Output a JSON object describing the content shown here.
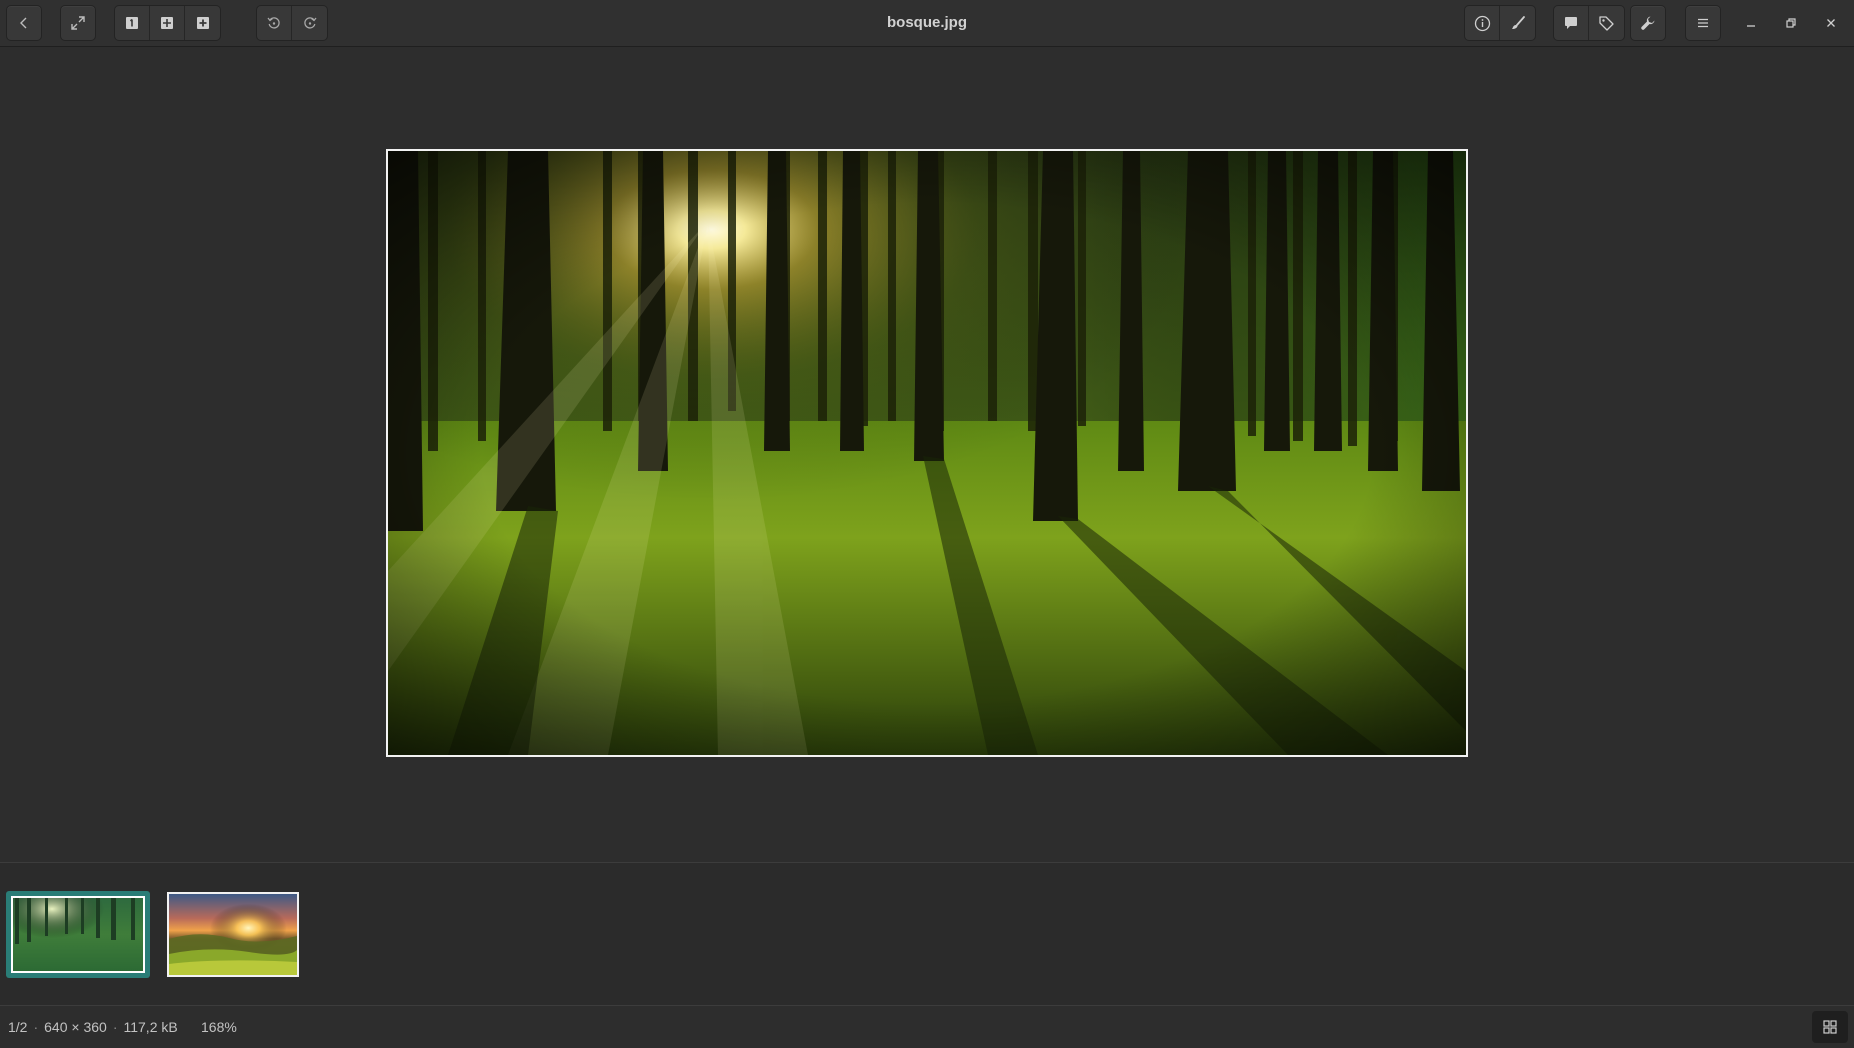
{
  "window": {
    "title": "bosque.jpg"
  },
  "header": {
    "back": {
      "icon": "chevron-left-icon"
    },
    "fullscreen": {
      "icon": "fullscreen-expand-icon"
    },
    "view_modes": [
      {
        "icon": "single-view-icon"
      },
      {
        "icon": "grid-view-icon"
      },
      {
        "icon": "add-view-icon"
      }
    ],
    "rotate_left": {
      "icon": "rotate-left-icon"
    },
    "rotate_right": {
      "icon": "rotate-right-icon"
    },
    "right_tools": [
      {
        "icon": "info-icon"
      },
      {
        "icon": "brush-icon"
      },
      {
        "icon": "comment-icon"
      },
      {
        "icon": "tag-icon"
      },
      {
        "icon": "wrench-icon"
      },
      {
        "icon": "hamburger-menu-icon"
      }
    ],
    "window_controls": [
      "minimize-icon",
      "restore-icon",
      "close-icon"
    ]
  },
  "image": {
    "name": "bosque.jpg",
    "scene": "forest-with-sunrays"
  },
  "thumbnails": [
    {
      "id": "bosque",
      "active": true
    },
    {
      "id": "sunset-hills",
      "active": false
    }
  ],
  "status": {
    "position": "1/2",
    "dimensions": "640 × 360",
    "filesize": "117,2 kB",
    "zoom": "168%"
  },
  "colors": {
    "accent": "#2a7d77",
    "background": "#2d2d2d",
    "headerbar": "#303030"
  }
}
